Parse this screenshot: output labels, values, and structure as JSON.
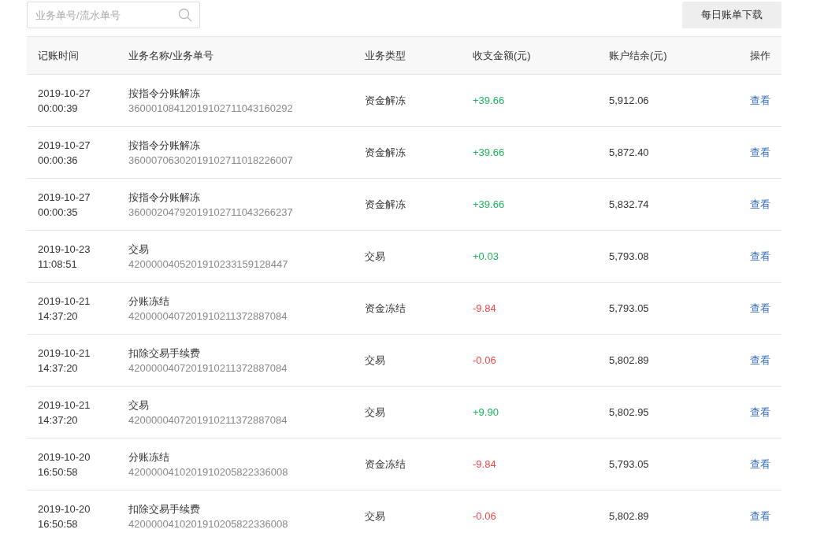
{
  "search": {
    "placeholder": "业务单号/流水单号"
  },
  "download_button": "每日账单下载",
  "table": {
    "columns": [
      "记账时间",
      "业务名称/业务单号",
      "业务类型",
      "收支金额(元)",
      "账户结余(元)",
      "操作"
    ],
    "rows": [
      {
        "date": "2019-10-27",
        "time": "00:00:39",
        "name": "按指令分账解冻",
        "number": "36000108412019102711043160292",
        "type": "资金解冻",
        "amount": "+39.66",
        "kind": "income",
        "balance": "5,912.06",
        "action": "查看"
      },
      {
        "date": "2019-10-27",
        "time": "00:00:36",
        "name": "按指令分账解冻",
        "number": "36000706302019102711018226007",
        "type": "资金解冻",
        "amount": "+39.66",
        "kind": "income",
        "balance": "5,872.40",
        "action": "查看"
      },
      {
        "date": "2019-10-27",
        "time": "00:00:35",
        "name": "按指令分账解冻",
        "number": "36000204792019102711043266237",
        "type": "资金解冻",
        "amount": "+39.66",
        "kind": "income",
        "balance": "5,832.74",
        "action": "查看"
      },
      {
        "date": "2019-10-23",
        "time": "11:08:51",
        "name": "交易",
        "number": "4200000405201910233159128447",
        "type": "交易",
        "amount": "+0.03",
        "kind": "income",
        "balance": "5,793.08",
        "action": "查看"
      },
      {
        "date": "2019-10-21",
        "time": "14:37:20",
        "name": "分账冻结",
        "number": "4200000407201910211372887084",
        "type": "资金冻结",
        "amount": "-9.84",
        "kind": "expense",
        "balance": "5,793.05",
        "action": "查看"
      },
      {
        "date": "2019-10-21",
        "time": "14:37:20",
        "name": "扣除交易手续费",
        "number": "4200000407201910211372887084",
        "type": "交易",
        "amount": "-0.06",
        "kind": "expense",
        "balance": "5,802.89",
        "action": "查看"
      },
      {
        "date": "2019-10-21",
        "time": "14:37:20",
        "name": "交易",
        "number": "4200000407201910211372887084",
        "type": "交易",
        "amount": "+9.90",
        "kind": "income",
        "balance": "5,802.95",
        "action": "查看"
      },
      {
        "date": "2019-10-20",
        "time": "16:50:58",
        "name": "分账冻结",
        "number": "4200000410201910205822336008",
        "type": "资金冻结",
        "amount": "-9.84",
        "kind": "expense",
        "balance": "5,793.05",
        "action": "查看"
      },
      {
        "date": "2019-10-20",
        "time": "16:50:58",
        "name": "扣除交易手续费",
        "number": "4200000410201910205822336008",
        "type": "交易",
        "amount": "-0.06",
        "kind": "expense",
        "balance": "5,802.89",
        "action": "查看"
      }
    ]
  }
}
